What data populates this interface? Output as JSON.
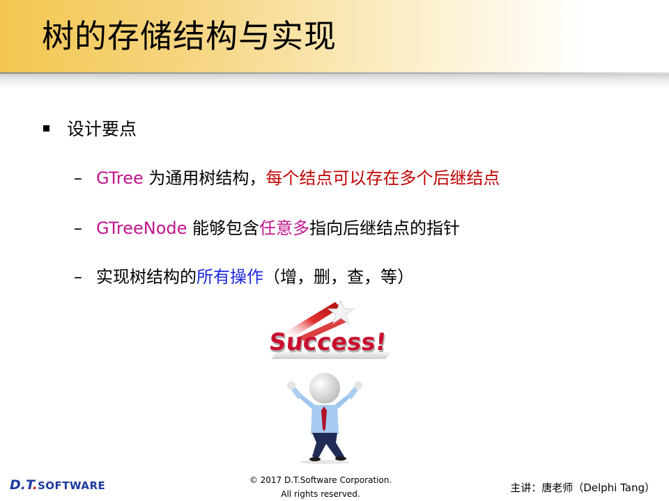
{
  "slide": {
    "title": "树的存储结构与实现"
  },
  "bullets": {
    "main": "设计要点",
    "items": [
      {
        "segments": [
          {
            "text": "GTree",
            "color": "magenta"
          },
          {
            "text": " 为通用树结构，",
            "color": "black"
          },
          {
            "text": "每个结点可以存在多个后继结点",
            "color": "red"
          }
        ]
      },
      {
        "segments": [
          {
            "text": "GTreeNode",
            "color": "magenta"
          },
          {
            "text": " 能够包含",
            "color": "black"
          },
          {
            "text": "任意多",
            "color": "magenta"
          },
          {
            "text": "指向后继结点的指针",
            "color": "black"
          }
        ]
      },
      {
        "segments": [
          {
            "text": "实现树结构的",
            "color": "black"
          },
          {
            "text": "所有操作",
            "color": "blue"
          },
          {
            "text": "（增，删，查，等）",
            "color": "black"
          }
        ]
      }
    ]
  },
  "illustration": {
    "word": "Success!",
    "icons": [
      "star-arrow-icon",
      "person-figure-icon"
    ]
  },
  "footer": {
    "logo_dt": "D.T",
    "logo_dot": ".",
    "logo_soft": "SOFTWARE",
    "copyright_line1": "© 2017 D.T.Software Corporation.",
    "copyright_line2": "All rights reserved.",
    "presenter": "主讲：唐老师（Delphi Tang）"
  },
  "colors": {
    "magenta": "#c0148c",
    "red": "#c00000",
    "blue": "#1d28e0",
    "title_band": "#f2c64f",
    "logo_blue": "#1d3aa0",
    "logo_red": "#d21a1a"
  }
}
